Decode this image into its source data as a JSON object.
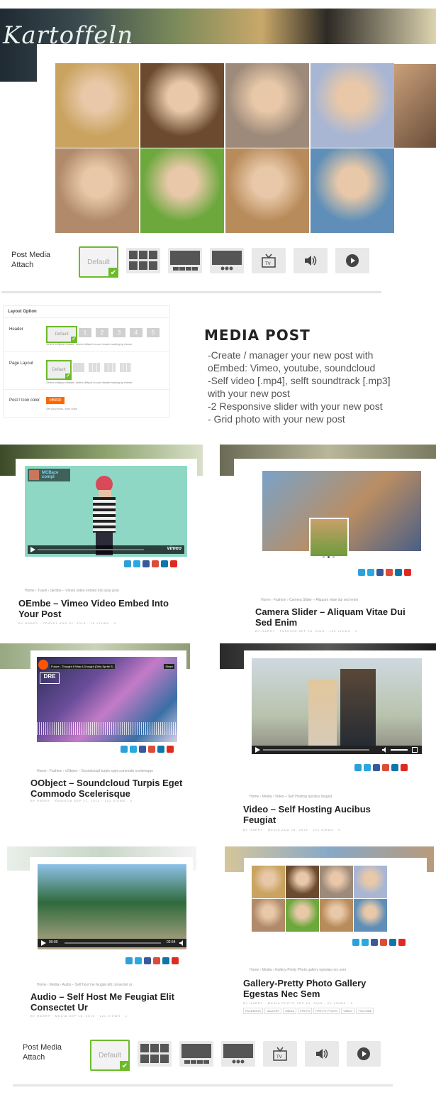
{
  "hero": {
    "banner_text": "Kartoffeln",
    "photos": [
      {
        "name": "photo-woman-flower-crown",
        "color": "#c9a35f"
      },
      {
        "name": "photo-hair-flowers",
        "color": "#6b4a2f"
      },
      {
        "name": "photo-couple-hug",
        "color": "#9d8a7a"
      },
      {
        "name": "photo-woman-purple-flowers",
        "color": "#a8b6d4"
      },
      {
        "name": "photo-man-portrait",
        "color": "#b08a6a"
      },
      {
        "name": "photo-woman-grass",
        "color": "#6da83d"
      },
      {
        "name": "photo-friends-selfie",
        "color": "#b88b5a"
      },
      {
        "name": "photo-palm-street",
        "color": "#5f8fb8"
      }
    ]
  },
  "attach1": {
    "label_line1": "Post Media",
    "label_line2": "Attach",
    "default_label": "Default"
  },
  "admin": {
    "title": "Layout Option",
    "header_label": "Header",
    "header_default": "Default",
    "header_nums": [
      "1",
      "2",
      "3",
      "4",
      "5"
    ],
    "header_help": "Select seftpost header, select default to use header setting by theme",
    "layout_label": "Page Layout",
    "layout_default": "Default",
    "layout_help": "Select seftpost header, select default to use header setting by theme",
    "color_label": "Post / Icon color",
    "color_value": "#ff6600",
    "color_help": "Set your post / icon color"
  },
  "media_post": {
    "title": "MEDIA POST",
    "lines": [
      "-Create / manager your new post with",
      "oEmbed: Vimeo, youtube, soundcloud",
      "-Self video [.mp4], selft soundtrack [.mp3]",
      "with your new post",
      "-2 Responsive slider with your new post",
      "- Grid photo with your new post"
    ]
  },
  "cards": {
    "c1": {
      "breadcrumb": "Home  ›  Travel  ›  oEmbe – Vimeo video embed into your post",
      "title_1": "OEmbe – Vimeo Video Embed Into",
      "title_2": "Your Post",
      "meta": "BY HARRY · TRAVEL  AUG 31, 2015  ·  78 VIEWS  ·  0",
      "player_title": "MCBaze compl",
      "player_brand": "vimeo"
    },
    "c2": {
      "breadcrumb": "Home  ›  Fashion  ›  Camera Slider – Aliquam vitae dui sed enim",
      "title_1": "Camera Slider – Aliquam Vitae Dui",
      "title_2": "Sed Enim",
      "meta": "BY HARRY · FASHION  SEP 16, 2015  ·  109 VIEWS  ·  1"
    },
    "c3": {
      "breadcrumb": "Home  ›  Fashion  ›  oObject – Soundcloud turpis eget commodo scelerisque",
      "title_1": "OObject – Soundcloud Turpis Eget",
      "title_2": "Commodo Scelerisque",
      "meta": "BY HARRY · FASHION  SEP 21, 2015  ·  122 VIEWS  ·  0",
      "player_title": "Future - Thought It Was A Drought (Dirty Sprite 2)",
      "player_share": "Share",
      "player_cover": "DRE"
    },
    "c4": {
      "breadcrumb": "Home  ›  Media  ›  Video – Self Hosting aucibus feugiat",
      "title_1": "Video – Self Hosting Aucibus",
      "title_2": "Feugiat",
      "meta": "BY HARRY · MEDIA  AUG 16, 2015  ·  132 VIEWS  ·  0"
    },
    "c5": {
      "breadcrumb": "Home  ›  Media  ›  Audio – Self host me feugiat elit consectet ur",
      "title_1": "Audio – Self Host Me Feugiat Elit",
      "title_2": "Consectet Ur",
      "meta": "BY HARRY · MEDIA  SEP 16, 2015  ·  121 VIEWS  ·  1",
      "time_start": "00:00",
      "time_end": "02:54"
    },
    "c6": {
      "breadcrumb": "Home  ›  Media  ›  Gallery-Pretty Photo gallery egestas nec sem",
      "title_1": "Gallery-Pretty Photo Gallery",
      "title_2": "Egestas Nec Sem",
      "meta": "BY HARRY · MEDIA PHOTO  SEP 16, 2015  ·  91 VIEWS  ·  0",
      "tags": [
        "FACEBOOK",
        "GALLERY",
        "MEDIA",
        "PHOTO",
        "PRETTY PHOTO",
        "VIMEO",
        "YOUTUBE"
      ]
    }
  },
  "social_colors": [
    "#2d9fd9",
    "#29a9e1",
    "#3b5998",
    "#dd4b39",
    "#0e76a8",
    "#e02a20"
  ],
  "attach2": {
    "label_line1": "Post Media",
    "label_line2": "Attach",
    "default_label": "Default"
  }
}
